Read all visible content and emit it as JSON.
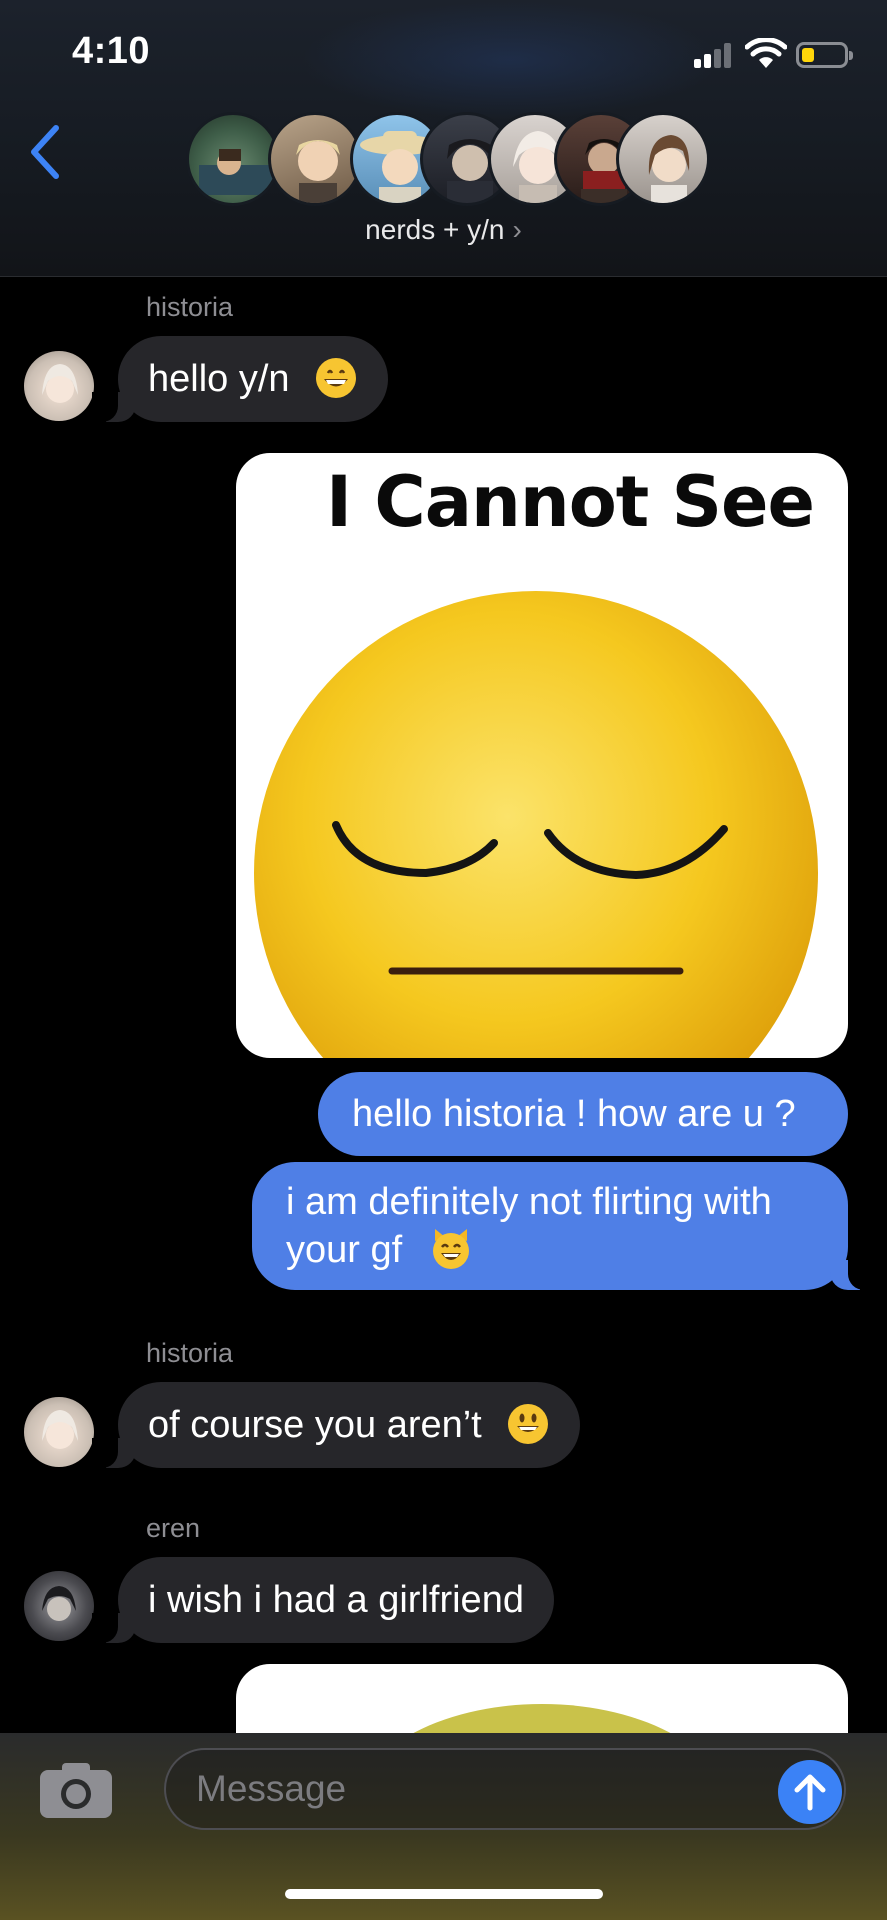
{
  "status_bar": {
    "time": "4:10"
  },
  "header": {
    "group_name": "nerds + y/n",
    "chevron": "›",
    "avatars": [
      "avatar-1",
      "avatar-2",
      "avatar-3",
      "avatar-4",
      "avatar-5",
      "avatar-6",
      "avatar-7"
    ]
  },
  "messages": [
    {
      "sender": "historia",
      "text": "hello y/n",
      "emoji": "grinning-face-icon"
    },
    {
      "type": "image",
      "caption": "I Cannot See"
    },
    {
      "from": "me",
      "text": "hello historia ! how are u ?"
    },
    {
      "from": "me",
      "line1": "i am definitely not flirting with",
      "line2": "your gf",
      "emoji": "smiling-cat-icon"
    },
    {
      "sender": "historia",
      "text": "of course you aren’t",
      "emoji": "smiley-face-icon"
    },
    {
      "sender": "eren",
      "text": "i wish i had a girlfriend"
    },
    {
      "type": "image"
    }
  ],
  "input": {
    "placeholder": "Message"
  },
  "colors": {
    "outgoing": "#4f7fe6",
    "incoming": "#26262a",
    "accent": "#3b82f6"
  }
}
